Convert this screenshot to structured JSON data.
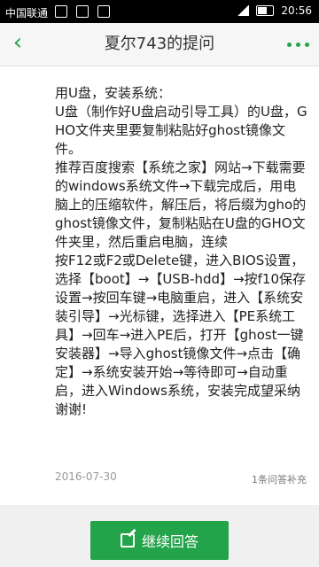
{
  "status_bar": {
    "carrier": "中国联通",
    "time": "20:56"
  },
  "header": {
    "title": "夏尔743的提问",
    "back_icon": "back-icon",
    "more_icon": "more-icon"
  },
  "answer": {
    "content": "用U盘，安装系统：\nU盘（制作好U盘启动引导工具）的U盘，GHO文件夹里要复制粘贴好ghost镜像文件。\n推荐百度搜索【系统之家】网站→下载需要的windows系统文件→下载完成后，用电脑上的压缩软件，解压后，将后缀为gho的ghost镜像文件，复制粘贴在U盘的GHO文件夹里，然后重启电脑，连续\n按F12或F2或Delete键，进入BIOS设置，选择【boot】→【USB-hdd】→按f10保存设置→按回车键→电脑重启，进入【系统安装引导】→光标键，选择进入【PE系统工具】→回车→进入PE后，打开【ghost一键安装器】→导入ghost镜像文件→点击【确定】→系统安装开始→等待即可→自动重启，进入Windows系统，安装完成望采纳谢谢!",
    "date": "2016-07-30",
    "reply_count": "1条问答补充"
  },
  "actions": {
    "continue_label": "继续回答"
  },
  "colors": {
    "accent": "#24a44a"
  }
}
